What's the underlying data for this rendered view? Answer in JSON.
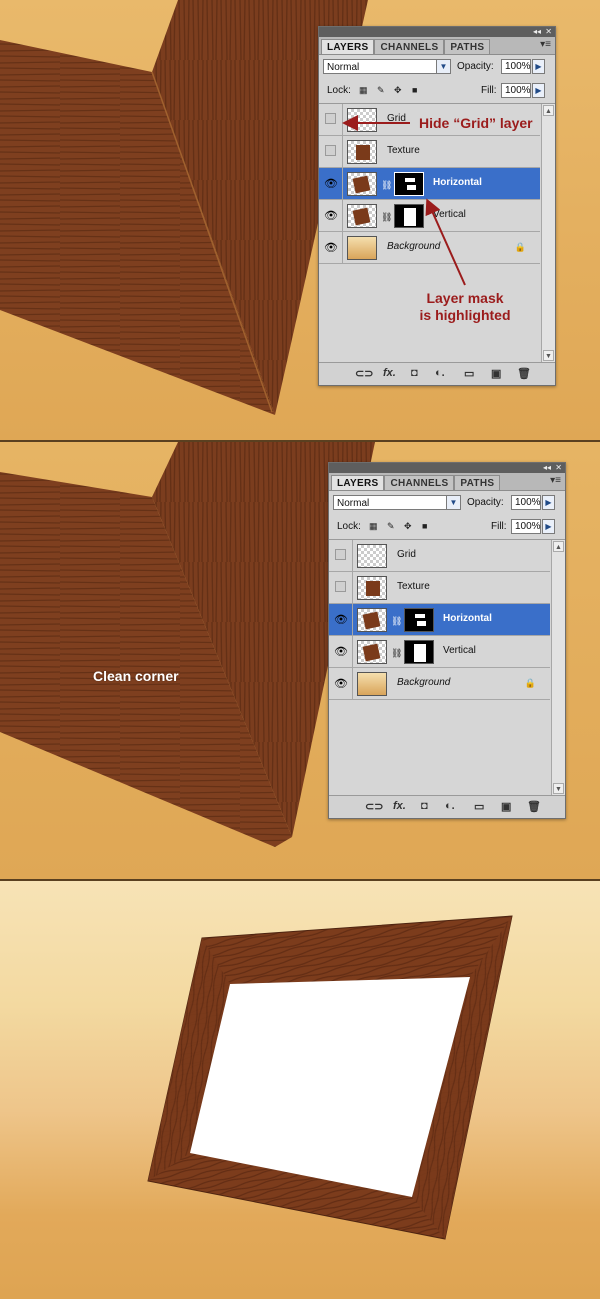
{
  "panel_top": {
    "tabs": [
      "LAYERS",
      "CHANNELS",
      "PATHS"
    ],
    "blend_mode": "Normal",
    "opacity_label": "Opacity:",
    "opacity_value": "100%",
    "lock_label": "Lock:",
    "fill_label": "Fill:",
    "fill_value": "100%",
    "layers": [
      {
        "name": "Grid",
        "visible": false
      },
      {
        "name": "Texture",
        "visible": false
      },
      {
        "name": "Horizontal",
        "visible": true,
        "selected": true
      },
      {
        "name": "Vertical",
        "visible": true
      },
      {
        "name": "Background",
        "visible": true,
        "locked": true
      }
    ]
  },
  "panel_bottom": {
    "tabs": [
      "LAYERS",
      "CHANNELS",
      "PATHS"
    ],
    "blend_mode": "Normal",
    "opacity_label": "Opacity:",
    "opacity_value": "100%",
    "lock_label": "Lock:",
    "fill_label": "Fill:",
    "fill_value": "100%",
    "layers": [
      {
        "name": "Grid",
        "visible": false
      },
      {
        "name": "Texture",
        "visible": false
      },
      {
        "name": "Horizontal",
        "visible": true,
        "selected": true
      },
      {
        "name": "Vertical",
        "visible": true
      },
      {
        "name": "Background",
        "visible": true,
        "locked": true
      }
    ]
  },
  "annotations": {
    "hide_grid": "Hide “Grid” layer",
    "mask_line1": "Layer mask",
    "mask_line2": "is highlighted",
    "clean_corner": "Clean corner"
  },
  "colors": {
    "annotation": "#9b1c1c",
    "selection": "#3a6fc9",
    "wood": "#7a3a1a",
    "background": "#e0ac5c"
  }
}
